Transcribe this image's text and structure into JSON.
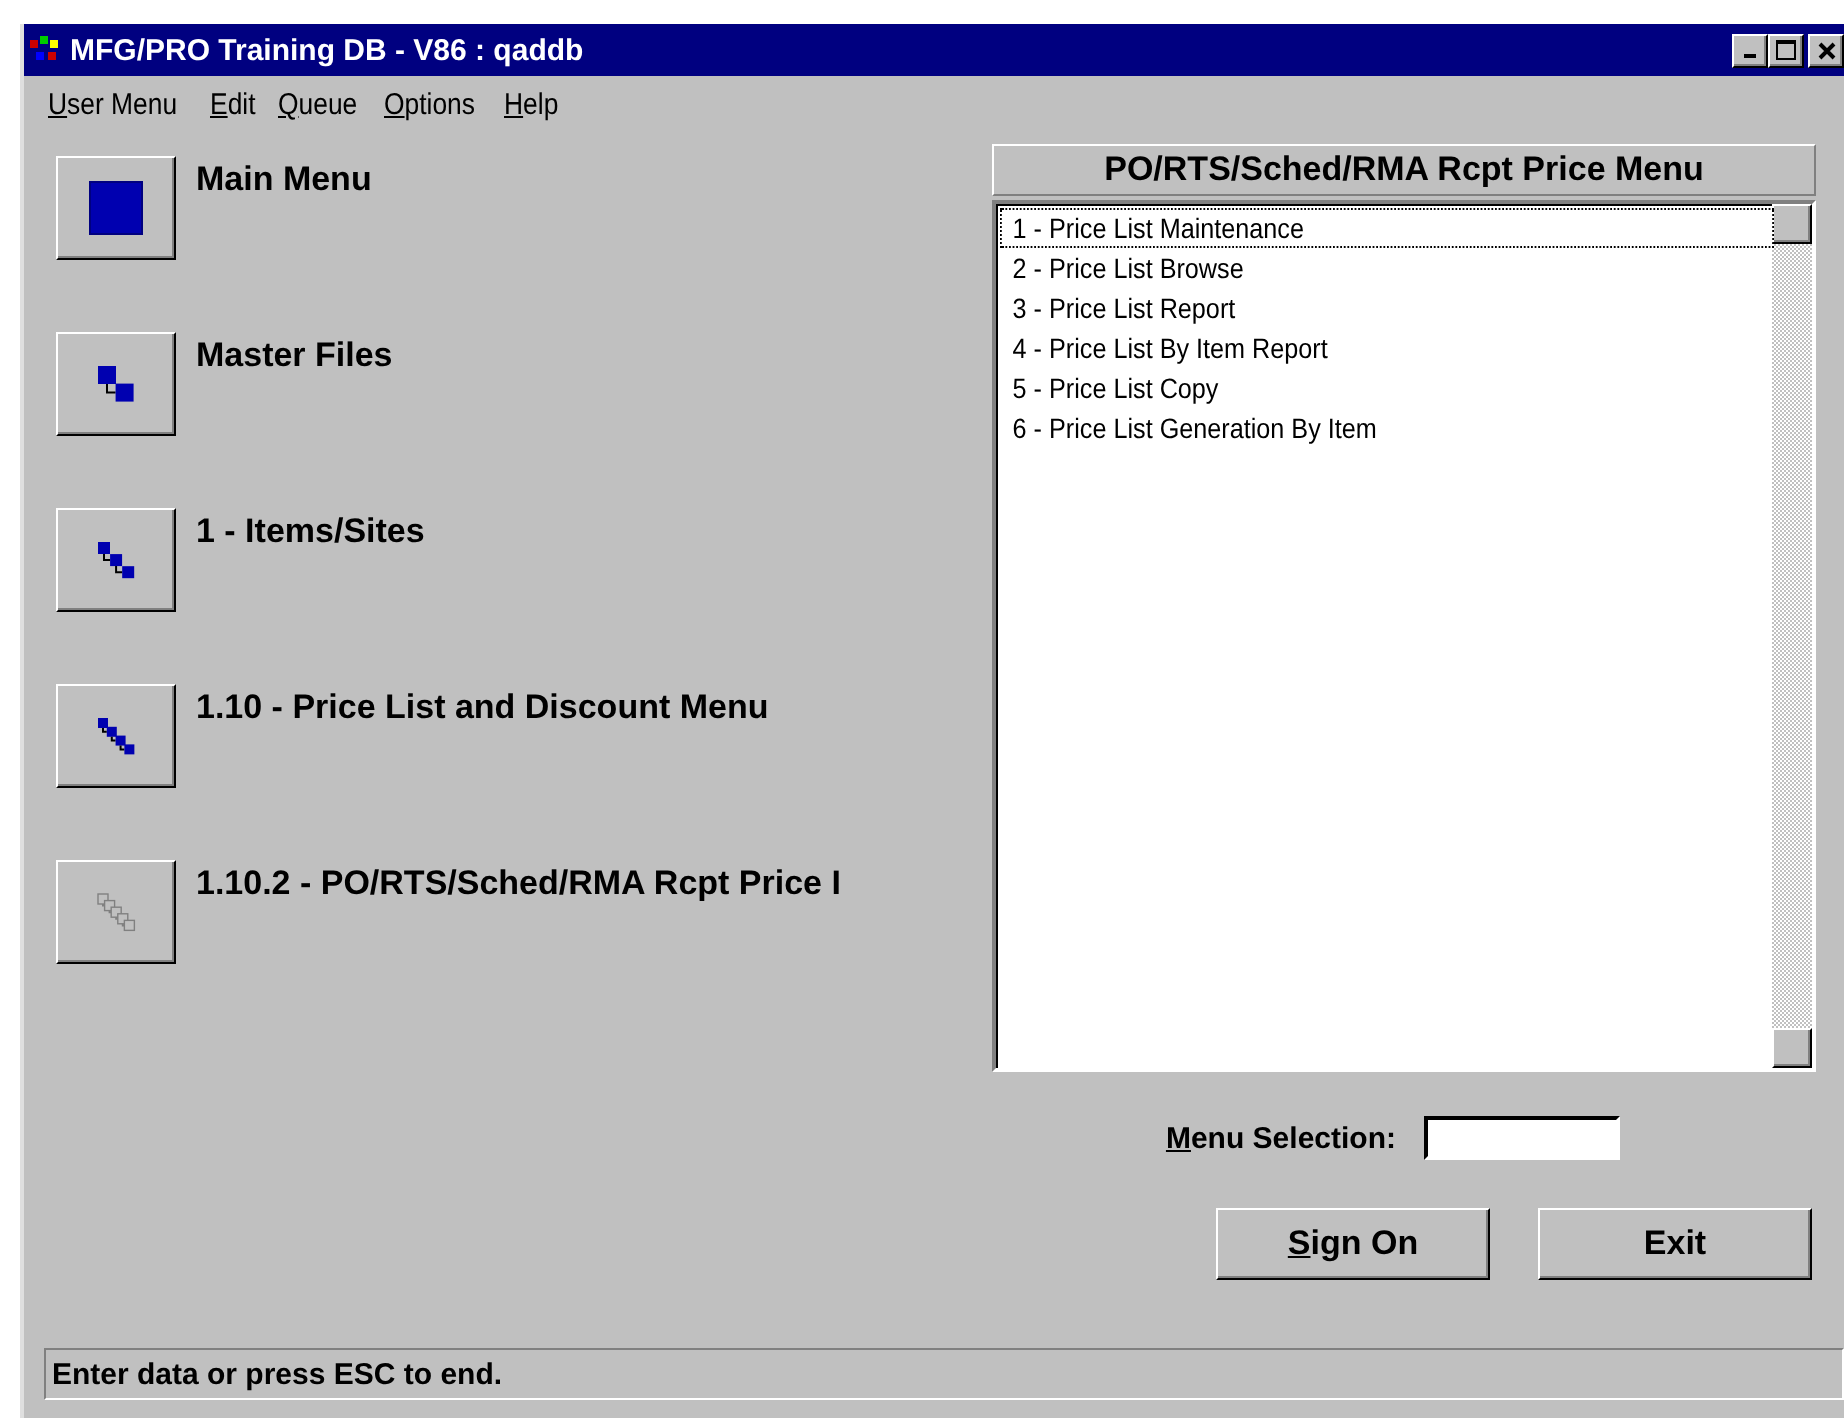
{
  "window": {
    "title": "MFG/PRO Training DB - V86 : qaddb"
  },
  "menu_bar": [
    "User Menu",
    "Edit",
    "Queue",
    "Options",
    "Help"
  ],
  "navigation": [
    {
      "label": "Main Menu",
      "disabled": false
    },
    {
      "label": "Master Files",
      "disabled": false
    },
    {
      "label": "1 - Items/Sites",
      "disabled": false
    },
    {
      "label": "1.10 - Price List and Discount Menu",
      "disabled": false
    },
    {
      "label": "1.10.2 - PO/RTS/Sched/RMA Rcpt Price I",
      "disabled": true
    }
  ],
  "menu_panel": {
    "title": "PO/RTS/Sched/RMA Rcpt Price Menu",
    "items": [
      {
        "label": "1 - Price List Maintenance",
        "selected": true
      },
      {
        "label": "2 - Price List Browse",
        "selected": false
      },
      {
        "label": "3 - Price List Report",
        "selected": false
      },
      {
        "label": "4 - Price List By Item Report",
        "selected": false
      },
      {
        "label": "5 - Price List Copy",
        "selected": false
      },
      {
        "label": "6 - Price List Generation By Item",
        "selected": false
      }
    ]
  },
  "menu_selection": {
    "label": "Menu Selection:"
  },
  "buttons": [
    "Sign On",
    "Exit"
  ],
  "status_bar": "Enter data or press ESC to end."
}
